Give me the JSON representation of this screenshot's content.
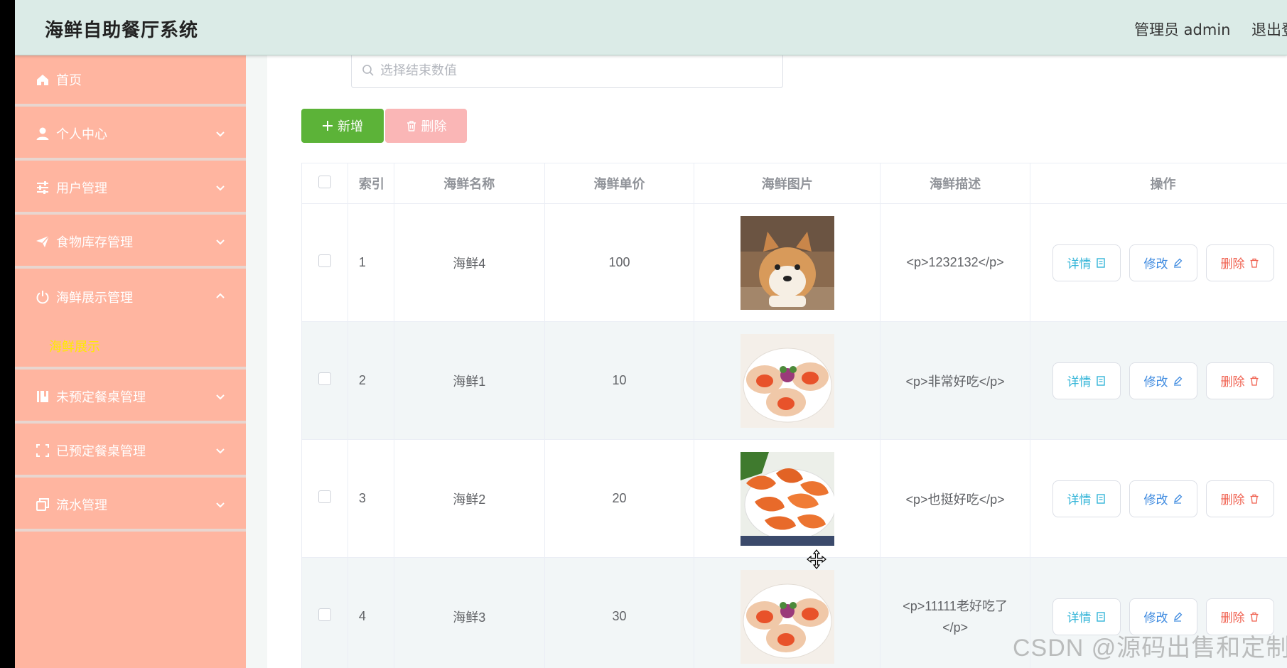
{
  "header": {
    "title": "海鲜自助餐厅系统",
    "admin": "管理员 admin",
    "logout": "退出登"
  },
  "sidebar": {
    "items": [
      {
        "label": "首页",
        "icon": "home-icon"
      },
      {
        "label": "个人中心",
        "icon": "user-icon"
      },
      {
        "label": "用户管理",
        "icon": "sliders-icon"
      },
      {
        "label": "食物库存管理",
        "icon": "send-icon"
      },
      {
        "label": "海鲜展示管理",
        "icon": "power-icon"
      },
      {
        "label": "未预定餐桌管理",
        "icon": "book-icon"
      },
      {
        "label": "已预定餐桌管理",
        "icon": "scan-icon"
      },
      {
        "label": "流水管理",
        "icon": "copy-icon"
      }
    ],
    "submenu": "海鲜展示",
    "active_color": "#ffea00"
  },
  "search": {
    "placeholder": "选择结束数值"
  },
  "toolbar": {
    "add_label": "新增",
    "delete_label": "删除"
  },
  "table": {
    "columns": [
      "索引",
      "海鲜名称",
      "海鲜单价",
      "海鲜图片",
      "海鲜描述",
      "操作"
    ],
    "rows": [
      {
        "index": "1",
        "name": "海鲜4",
        "price": "100",
        "image": "dog-photo",
        "desc": "<p>1232132</p>"
      },
      {
        "index": "2",
        "name": "海鲜1",
        "price": "10",
        "image": "scallop-photo",
        "desc": "<p>非常好吃</p>"
      },
      {
        "index": "3",
        "name": "海鲜2",
        "price": "20",
        "image": "shrimp-photo",
        "desc": "<p>也挺好吃</p>"
      },
      {
        "index": "4",
        "name": "海鲜3",
        "price": "30",
        "image": "scallop-photo",
        "desc": "<p>11111老好吃了</p>"
      }
    ],
    "actions": {
      "detail": "详情",
      "edit": "修改",
      "delete": "删除"
    }
  },
  "watermark": "CSDN @源码出售和定制",
  "colors": {
    "sidebar": "#ffb5a0",
    "header": "#dbebe7",
    "add": "#5cb338",
    "delete": "#fab6b6"
  }
}
